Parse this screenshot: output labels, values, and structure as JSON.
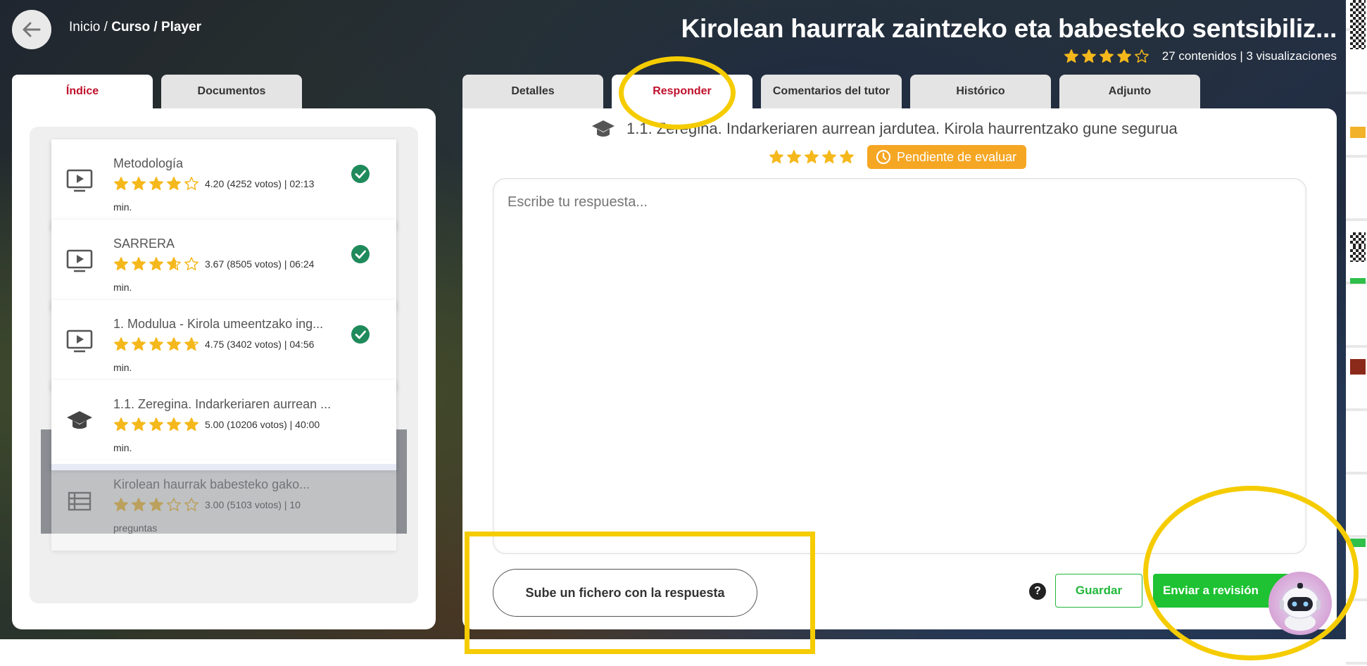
{
  "header": {
    "breadcrumb_home": "Inicio",
    "breadcrumb_sep1": " / ",
    "breadcrumb_course": "Curso",
    "breadcrumb_sep2": " / ",
    "breadcrumb_player": "Player",
    "course_title": "Kirolean haurrak zaintzeko eta babesteko sentsibiliz...",
    "course_rating": 4,
    "course_stats": "27 contenidos | 3 visualizaciones"
  },
  "left_tabs": [
    {
      "label": "Índice",
      "active": true
    },
    {
      "label": "Documentos",
      "active": false
    }
  ],
  "lessons": [
    {
      "title": "Metodología",
      "stars": 4.2,
      "rating_text": "4.20 (4252 votos) | 02:13",
      "min_text": "min.",
      "icon": "video-icon",
      "completed": true
    },
    {
      "title": "SARRERA",
      "stars": 3.67,
      "rating_text": "3.67 (8505 votos) | 06:24",
      "min_text": "min.",
      "icon": "video-icon",
      "completed": true
    },
    {
      "title": "1. Modulua - Kirola umeentzako ing...",
      "stars": 4.75,
      "rating_text": "4.75 (3402 votos) | 04:56",
      "min_text": "min.",
      "icon": "video-icon",
      "completed": true
    },
    {
      "title": "1.1. Zeregina. Indarkeriaren aurrean ...",
      "stars": 5,
      "rating_text": "5.00 (10206 votos) | 40:00",
      "min_text": "min.",
      "icon": "graduation-cap-icon",
      "completed": false,
      "current": true
    },
    {
      "title": "Kirolean haurrak babesteko gako...",
      "stars": 3,
      "rating_text": "3.00 (5103 votos) | 10",
      "min_text": "preguntas",
      "icon": "list-icon",
      "completed": false
    }
  ],
  "right_tabs": [
    {
      "label": "Detalles",
      "active": false
    },
    {
      "label": "Responder",
      "active": true
    },
    {
      "label": "Comentarios del tutor",
      "active": false
    },
    {
      "label": "Histórico",
      "active": false
    },
    {
      "label": "Adjunto",
      "active": false
    }
  ],
  "task": {
    "title": "1.1. Zeregina. Indarkeriaren aurrean jardutea. Kirola haurrentzako gune segurua",
    "rating": 5,
    "status": "Pendiente de evaluar"
  },
  "answer": {
    "placeholder": "Escribe tu respuesta..."
  },
  "actions": {
    "upload_label": "Sube un fichero con la respuesta",
    "help": "?",
    "save_label": "Guardar",
    "send_label": "Enviar a revisión"
  },
  "colors": {
    "active_tab": "#c0102b",
    "star": "#f5b81c",
    "progress": "#1b9b35",
    "pending": "#f5a623",
    "send": "#1ec232",
    "annotation": "#f5cc00"
  }
}
